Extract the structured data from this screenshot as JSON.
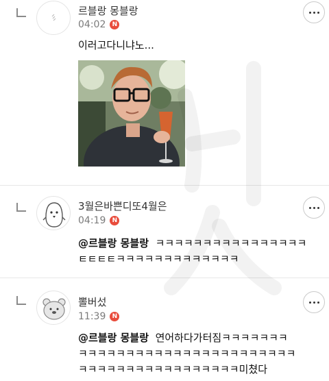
{
  "comments": [
    {
      "author": "르블랑 몽블랑",
      "time": "04:02",
      "badge": "N",
      "text": "이러고다니냐노...",
      "has_image": true
    },
    {
      "author": "3월은바쁜디또4월은",
      "time": "04:19",
      "badge": "N",
      "mention": "@르블랑 몽블랑",
      "lines": [
        "ㅋㅋㅋㅋㅋㅋㅋㅋㅋㅋㅋㅋㅋㅋㅋㅋ",
        "ㅌㅌㅌㅌㅋㅋㅋㅋㅋㅋㅋㅋㅋㅋㅋㅋㅋ"
      ]
    },
    {
      "author": "뽈버섰",
      "time": "11:39",
      "badge": "N",
      "mention": "@르블랑 몽블랑",
      "lines": [
        "연어하다가터짐ㅋㅋㅋㅋㅋㅋㅋ",
        "ㅋㅋㅋㅋㅋㅋㅋㅋㅋㅋㅋㅋㅋㅋㅋㅋㅋㅋㅋㅋㅋㅋㅋ",
        "ㅋㅋㅋㅋㅋㅋㅋㅋㅋㅋㅋㅋㅋㅋㅋㅋㅋ미쳤다"
      ]
    }
  ],
  "icons": {
    "reply": "reply-arrow-icon",
    "more": "more-options-icon",
    "badge_color": "#e94c3c"
  }
}
